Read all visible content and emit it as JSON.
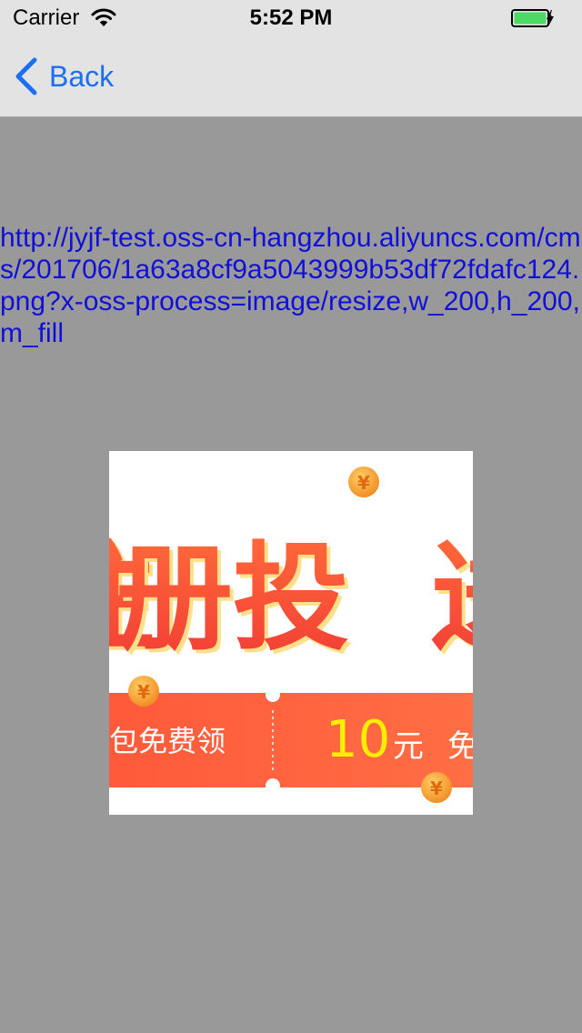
{
  "status_bar": {
    "carrier": "Carrier",
    "time": "5:52 PM",
    "wifi_icon": "wifi-icon",
    "battery_icon": "battery-charging-icon",
    "battery_color": "#4cd964"
  },
  "nav": {
    "back_label": "Back",
    "back_icon": "chevron-left-icon",
    "accent": "#1a6ff5"
  },
  "content": {
    "url_text": "http://jyjf-test.oss-cn-hangzhou.aliyuncs.com/cms/201706/1a63a8cf9a5043999b53df72fdafc124.png?x-oss-process=image/resize,w_200,h_200,m_fill",
    "url_color": "#1010d8",
    "background": "#999999"
  },
  "image": {
    "headline": "册投",
    "banner_left": "包免费领",
    "banner_amount": "10",
    "banner_unit": "元",
    "banner_right": "免",
    "coin_icon": "yen-coin-icon"
  }
}
